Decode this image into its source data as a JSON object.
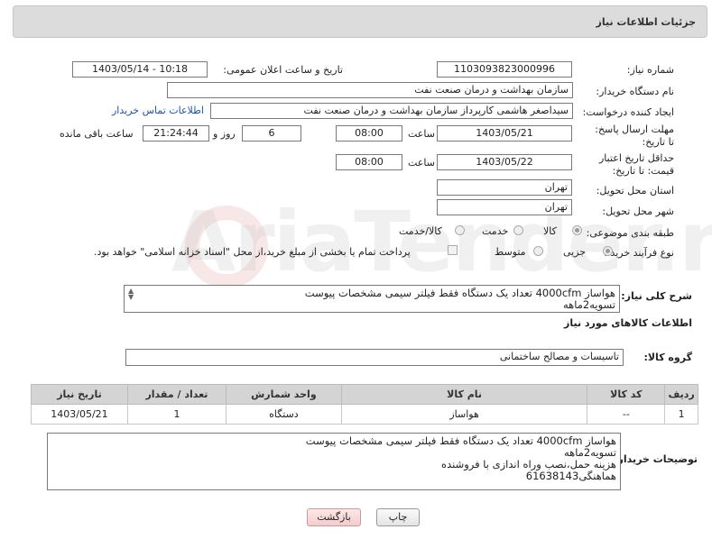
{
  "panel": {
    "title": "جزئیات اطلاعات نیاز"
  },
  "fields": {
    "need_number": {
      "label": "شماره نیاز:",
      "value": "1103093823000996"
    },
    "announce": {
      "label": "تاریخ و ساعت اعلان عمومی:",
      "value": "1403/05/14 - 10:18"
    },
    "buyer_org": {
      "label": "نام دستگاه خریدار:",
      "value": "سازمان بهداشت و درمان صنعت نفت"
    },
    "creator": {
      "label": "ایجاد کننده درخواست:",
      "value": "سیداصغر هاشمی کارپرداز سازمان بهداشت و درمان صنعت نفت",
      "contact_link": "اطلاعات تماس خریدار"
    },
    "reply_deadline": {
      "label": "مهلت ارسال پاسخ: تا تاریخ:",
      "date": "1403/05/21",
      "time_label": "ساعت",
      "time": "08:00",
      "days": "6",
      "days_label": "روز و",
      "remaining": "21:24:44",
      "remaining_label": "ساعت باقی مانده"
    },
    "price_validity": {
      "label": "حداقل تاریخ اعتبار قیمت: تا تاریخ:",
      "date": "1403/05/22",
      "time_label": "ساعت",
      "time": "08:00"
    },
    "province": {
      "label": "استان محل تحویل:",
      "value": "تهران"
    },
    "city": {
      "label": "شهر محل تحویل:",
      "value": "تهران"
    },
    "category": {
      "label": "طبقه بندی موضوعی:",
      "options": [
        "کالا",
        "خدمت",
        "کالا/خدمت"
      ],
      "selected": "کالا"
    },
    "purchase_type": {
      "label": "نوع فرآیند خرید :",
      "options": [
        "جزیی",
        "متوسط"
      ],
      "selected": "جزیی",
      "treasury_note": "پرداخت تمام یا بخشی از مبلغ خرید،از محل \"اسناد خزانه اسلامی\" خواهد بود."
    }
  },
  "summary": {
    "label": "شرح کلی نیاز:",
    "text": "هواساز 4000cfm تعداد یک دستگاه فقط فیلتر سیمی مشخصات پیوست\nتسویه2ماهه"
  },
  "goods_info": {
    "title": "اطلاعات کالاهای مورد نیاز",
    "group_label": "گروه کالا:",
    "group_value": "تاسیسات و مصالح ساختمانی"
  },
  "table": {
    "headers": [
      "ردیف",
      "کد کالا",
      "نام کالا",
      "واحد شمارش",
      "تعداد / مقدار",
      "تاریخ نیاز"
    ],
    "rows": [
      [
        "1",
        "--",
        "هواساز",
        "دستگاه",
        "1",
        "1403/05/21"
      ]
    ]
  },
  "buyer_notes": {
    "label": "توضیحات خریدار:",
    "text": "هواساز 4000cfm تعداد یک دستگاه فقط فیلتر سیمی مشخصات پیوست\nتسویه2ماهه\nهزینه حمل،نصب وراه اندازی با فروشنده\nهماهنگی61638143"
  },
  "buttons": {
    "print": "چاپ",
    "back": "بازگشت"
  },
  "watermark": "AriaTender.net"
}
